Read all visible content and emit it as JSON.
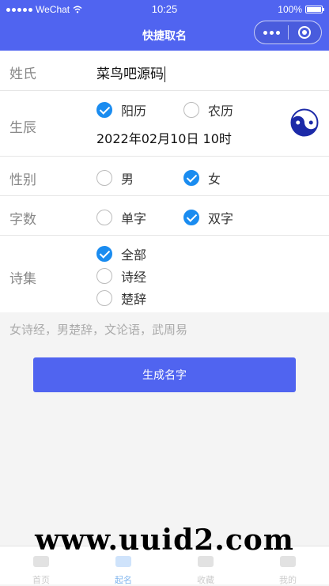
{
  "status_bar": {
    "carrier": "WeChat",
    "time": "10:25",
    "battery": "100%"
  },
  "nav": {
    "title": "快捷取名"
  },
  "form": {
    "surname": {
      "label": "姓氏",
      "value": "菜鸟吧源码"
    },
    "birth": {
      "label": "生辰",
      "calendar_options": [
        {
          "label": "阳历",
          "checked": true
        },
        {
          "label": "农历",
          "checked": false
        }
      ],
      "datetime": "2022年02月10日 10时"
    },
    "gender": {
      "label": "性别",
      "options": [
        {
          "label": "男",
          "checked": false
        },
        {
          "label": "女",
          "checked": true
        }
      ]
    },
    "word_count": {
      "label": "字数",
      "options": [
        {
          "label": "单字",
          "checked": false
        },
        {
          "label": "双字",
          "checked": true
        }
      ]
    },
    "poetry": {
      "label": "诗集",
      "options": [
        {
          "label": "全部",
          "checked": true
        },
        {
          "label": "诗经",
          "checked": false
        },
        {
          "label": "楚辞",
          "checked": false
        }
      ]
    }
  },
  "hint": "女诗经，男楚辞，文论语，武周易",
  "generate_button": "生成名字",
  "tabbar": {
    "tabs": [
      {
        "label": "首页",
        "active": false
      },
      {
        "label": "起名",
        "active": true
      },
      {
        "label": "收藏",
        "active": false
      },
      {
        "label": "我的",
        "active": false
      }
    ]
  },
  "watermark": "www.uuid2.com",
  "colors": {
    "primary": "#5064f0",
    "check": "#1a8cf0"
  }
}
